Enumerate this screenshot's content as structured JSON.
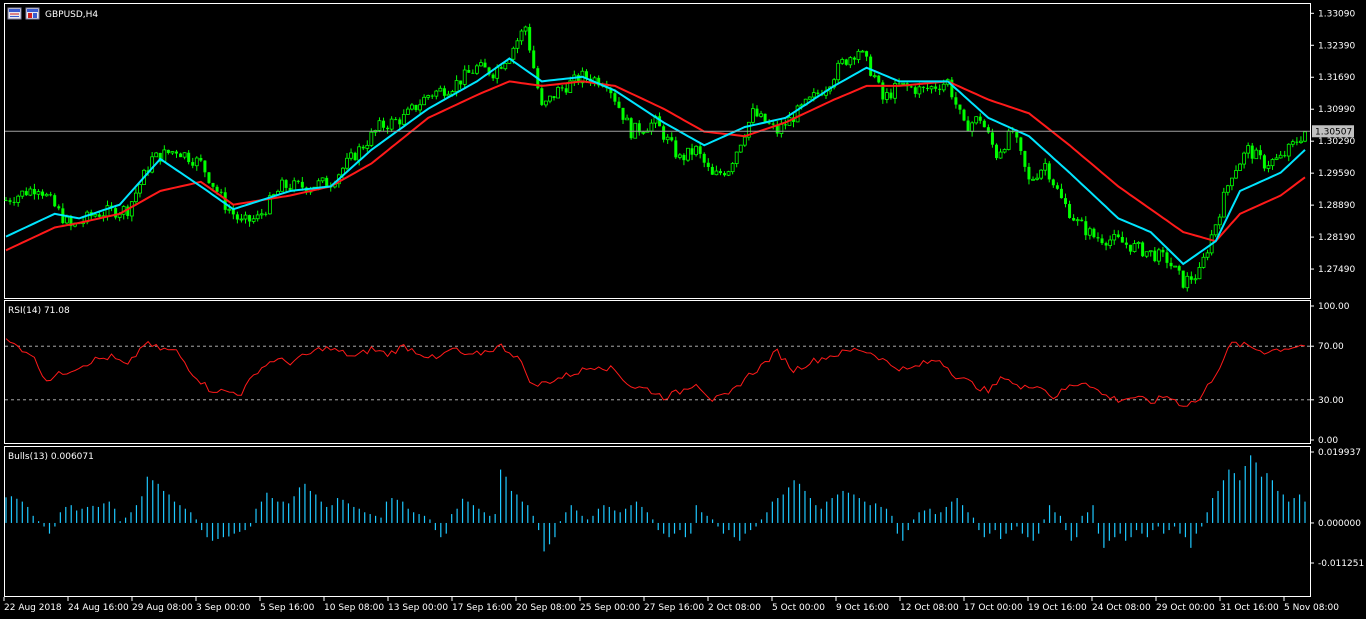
{
  "window": {
    "symbol_title": "GBPUSD,H4",
    "current_price_tag": "1.30507"
  },
  "colors": {
    "background": "#000000",
    "frame": "#ffffff",
    "candle": "#00ff00",
    "ma_fast": "#00e5ff",
    "ma_slow": "#ff1a1a",
    "rsi_line": "#ff1a1a",
    "bulls_hist": "#1ec8ff",
    "level_line": "#c0c0c0"
  },
  "icons": [
    "chart-window-icon",
    "chart-symbol-icon"
  ],
  "chart_data": [
    {
      "type": "candlestick",
      "symbol": "GBPUSD,H4",
      "ylim": [
        1.269,
        1.3325
      ],
      "y_ticks": [
        "1.33090",
        "1.32390",
        "1.31690",
        "1.30990",
        "1.30290",
        "1.29590",
        "1.28890",
        "1.28190",
        "1.27490"
      ],
      "current_price": 1.30507,
      "x_labels": [
        "22 Aug 2018",
        "24 Aug 16:00",
        "29 Aug 08:00",
        "3 Sep 00:00",
        "5 Sep 16:00",
        "10 Sep 08:00",
        "13 Sep 00:00",
        "17 Sep 16:00",
        "20 Sep 08:00",
        "25 Sep 00:00",
        "27 Sep 16:00",
        "2 Oct 08:00",
        "5 Oct 00:00",
        "9 Oct 16:00",
        "12 Oct 08:00",
        "17 Oct 00:00",
        "19 Oct 16:00",
        "24 Oct 08:00",
        "29 Oct 00:00",
        "31 Oct 16:00",
        "5 Nov 08:00"
      ],
      "close_path": [
        [
          0,
          1.29
        ],
        [
          8,
          1.293
        ],
        [
          16,
          1.284
        ],
        [
          22,
          1.287
        ],
        [
          30,
          1.288
        ],
        [
          36,
          1.299
        ],
        [
          42,
          1.301
        ],
        [
          48,
          1.298
        ],
        [
          54,
          1.289
        ],
        [
          58,
          1.285
        ],
        [
          62,
          1.286
        ],
        [
          68,
          1.293
        ],
        [
          74,
          1.293
        ],
        [
          80,
          1.294
        ],
        [
          86,
          1.3
        ],
        [
          92,
          1.306
        ],
        [
          98,
          1.308
        ],
        [
          104,
          1.313
        ],
        [
          110,
          1.315
        ],
        [
          116,
          1.319
        ],
        [
          120,
          1.318
        ],
        [
          124,
          1.322
        ],
        [
          128,
          1.328
        ],
        [
          132,
          1.31
        ],
        [
          136,
          1.314
        ],
        [
          142,
          1.317
        ],
        [
          148,
          1.316
        ],
        [
          154,
          1.305
        ],
        [
          160,
          1.307
        ],
        [
          166,
          1.299
        ],
        [
          170,
          1.301
        ],
        [
          174,
          1.295
        ],
        [
          178,
          1.297
        ],
        [
          184,
          1.309
        ],
        [
          190,
          1.305
        ],
        [
          196,
          1.31
        ],
        [
          202,
          1.315
        ],
        [
          206,
          1.32
        ],
        [
          210,
          1.323
        ],
        [
          214,
          1.317
        ],
        [
          216,
          1.312
        ],
        [
          220,
          1.315
        ],
        [
          226,
          1.314
        ],
        [
          232,
          1.316
        ],
        [
          236,
          1.306
        ],
        [
          240,
          1.308
        ],
        [
          244,
          1.3
        ],
        [
          248,
          1.305
        ],
        [
          252,
          1.294
        ],
        [
          256,
          1.298
        ],
        [
          260,
          1.29
        ],
        [
          264,
          1.285
        ],
        [
          268,
          1.282
        ],
        [
          274,
          1.281
        ],
        [
          280,
          1.279
        ],
        [
          286,
          1.277
        ],
        [
          290,
          1.272
        ],
        [
          294,
          1.274
        ],
        [
          298,
          1.285
        ],
        [
          302,
          1.296
        ],
        [
          306,
          1.301
        ],
        [
          310,
          1.298
        ],
        [
          314,
          1.299
        ],
        [
          320,
          1.305
        ]
      ],
      "ma_fast_path": [
        [
          0,
          1.282
        ],
        [
          12,
          1.287
        ],
        [
          18,
          1.286
        ],
        [
          28,
          1.289
        ],
        [
          38,
          1.299
        ],
        [
          48,
          1.293
        ],
        [
          56,
          1.288
        ],
        [
          70,
          1.292
        ],
        [
          80,
          1.293
        ],
        [
          90,
          1.301
        ],
        [
          104,
          1.31
        ],
        [
          116,
          1.316
        ],
        [
          124,
          1.321
        ],
        [
          132,
          1.316
        ],
        [
          142,
          1.317
        ],
        [
          150,
          1.314
        ],
        [
          162,
          1.307
        ],
        [
          172,
          1.302
        ],
        [
          182,
          1.306
        ],
        [
          192,
          1.308
        ],
        [
          204,
          1.315
        ],
        [
          212,
          1.319
        ],
        [
          220,
          1.316
        ],
        [
          232,
          1.316
        ],
        [
          242,
          1.308
        ],
        [
          252,
          1.304
        ],
        [
          262,
          1.296
        ],
        [
          274,
          1.286
        ],
        [
          282,
          1.283
        ],
        [
          290,
          1.276
        ],
        [
          298,
          1.281
        ],
        [
          304,
          1.292
        ],
        [
          314,
          1.296
        ],
        [
          320,
          1.301
        ]
      ],
      "ma_slow_path": [
        [
          0,
          1.279
        ],
        [
          12,
          1.284
        ],
        [
          18,
          1.285
        ],
        [
          28,
          1.287
        ],
        [
          38,
          1.292
        ],
        [
          48,
          1.294
        ],
        [
          56,
          1.289
        ],
        [
          70,
          1.291
        ],
        [
          80,
          1.293
        ],
        [
          90,
          1.298
        ],
        [
          104,
          1.308
        ],
        [
          116,
          1.313
        ],
        [
          124,
          1.316
        ],
        [
          132,
          1.315
        ],
        [
          142,
          1.316
        ],
        [
          150,
          1.315
        ],
        [
          162,
          1.31
        ],
        [
          172,
          1.305
        ],
        [
          182,
          1.304
        ],
        [
          192,
          1.307
        ],
        [
          204,
          1.312
        ],
        [
          212,
          1.315
        ],
        [
          220,
          1.315
        ],
        [
          232,
          1.316
        ],
        [
          242,
          1.312
        ],
        [
          252,
          1.309
        ],
        [
          262,
          1.302
        ],
        [
          274,
          1.293
        ],
        [
          282,
          1.288
        ],
        [
          290,
          1.283
        ],
        [
          298,
          1.281
        ],
        [
          304,
          1.287
        ],
        [
          314,
          1.291
        ],
        [
          320,
          1.295
        ]
      ]
    },
    {
      "type": "line",
      "title": "RSI(14) 71.08",
      "ylim": [
        0,
        100
      ],
      "y_ticks": [
        "100.00",
        "70.00",
        "30.00",
        "0.00"
      ],
      "levels": [
        70,
        30
      ],
      "series": [
        {
          "name": "RSI(14)",
          "points": [
            [
              0,
              74
            ],
            [
              6,
              65
            ],
            [
              10,
              45
            ],
            [
              14,
              50
            ],
            [
              18,
              55
            ],
            [
              22,
              60
            ],
            [
              26,
              62
            ],
            [
              30,
              55
            ],
            [
              34,
              72
            ],
            [
              38,
              68
            ],
            [
              42,
              66
            ],
            [
              46,
              50
            ],
            [
              50,
              38
            ],
            [
              54,
              36
            ],
            [
              58,
              35
            ],
            [
              62,
              52
            ],
            [
              66,
              60
            ],
            [
              70,
              58
            ],
            [
              74,
              63
            ],
            [
              78,
              69
            ],
            [
              82,
              66
            ],
            [
              86,
              62
            ],
            [
              90,
              68
            ],
            [
              94,
              64
            ],
            [
              98,
              70
            ],
            [
              102,
              65
            ],
            [
              106,
              60
            ],
            [
              110,
              68
            ],
            [
              114,
              62
            ],
            [
              118,
              66
            ],
            [
              122,
              70
            ],
            [
              126,
              62
            ],
            [
              130,
              40
            ],
            [
              134,
              44
            ],
            [
              138,
              48
            ],
            [
              142,
              52
            ],
            [
              146,
              56
            ],
            [
              150,
              52
            ],
            [
              154,
              40
            ],
            [
              158,
              38
            ],
            [
              162,
              32
            ],
            [
              166,
              36
            ],
            [
              170,
              43
            ],
            [
              174,
              30
            ],
            [
              178,
              33
            ],
            [
              182,
              46
            ],
            [
              186,
              55
            ],
            [
              190,
              66
            ],
            [
              194,
              52
            ],
            [
              198,
              58
            ],
            [
              202,
              62
            ],
            [
              206,
              65
            ],
            [
              210,
              68
            ],
            [
              214,
              64
            ],
            [
              218,
              56
            ],
            [
              222,
              52
            ],
            [
              226,
              57
            ],
            [
              230,
              60
            ],
            [
              234,
              48
            ],
            [
              238,
              42
            ],
            [
              242,
              36
            ],
            [
              246,
              48
            ],
            [
              250,
              38
            ],
            [
              254,
              42
            ],
            [
              258,
              32
            ],
            [
              262,
              40
            ],
            [
              266,
              44
            ],
            [
              270,
              34
            ],
            [
              274,
              30
            ],
            [
              278,
              32
            ],
            [
              282,
              28
            ],
            [
              286,
              33
            ],
            [
              290,
              26
            ],
            [
              294,
              30
            ],
            [
              298,
              50
            ],
            [
              302,
              72
            ],
            [
              306,
              70
            ],
            [
              310,
              66
            ],
            [
              314,
              68
            ],
            [
              320,
              71
            ]
          ]
        }
      ]
    },
    {
      "type": "bar",
      "title": "Bulls(13) 0.006071",
      "ylim": [
        -0.011251,
        0.019937
      ],
      "y_ticks": [
        "0.019937",
        "0.000000",
        "-0.011251"
      ],
      "series": [
        {
          "name": "Bulls(13)",
          "values": [
            0.0072,
            0.0075,
            0.0068,
            0.006,
            0.0045,
            0.002,
            0.0005,
            -0.001,
            -0.003,
            -0.001,
            0.003,
            0.0045,
            0.005,
            0.0035,
            0.004,
            0.0045,
            0.0048,
            0.0045,
            0.0055,
            0.006,
            0.004,
            0.0005,
            0.0015,
            0.003,
            0.005,
            0.0075,
            0.013,
            0.012,
            0.011,
            0.009,
            0.008,
            0.006,
            0.005,
            0.004,
            0.003,
            0.001,
            -0.002,
            -0.004,
            -0.005,
            -0.0045,
            -0.004,
            -0.0038,
            -0.003,
            -0.0025,
            -0.002,
            -0.001,
            0.004,
            0.006,
            0.0085,
            0.007,
            0.006,
            0.006,
            0.0055,
            0.0075,
            0.01,
            0.011,
            0.009,
            0.008,
            0.006,
            0.0045,
            0.005,
            0.007,
            0.0065,
            0.0055,
            0.0045,
            0.004,
            0.003,
            0.0025,
            0.002,
            0.0015,
            0.006,
            0.007,
            0.0065,
            0.006,
            0.004,
            0.003,
            0.0025,
            0.002,
            0.001,
            -0.002,
            -0.004,
            -0.003,
            0.0025,
            0.004,
            0.0068,
            0.006,
            0.005,
            0.004,
            0.003,
            0.002,
            0.0025,
            0.015,
            0.013,
            0.009,
            0.008,
            0.006,
            0.005,
            0.002,
            -0.002,
            -0.008,
            -0.006,
            -0.004,
            0.0005,
            0.003,
            0.005,
            0.0035,
            0.002,
            0.001,
            0.002,
            0.004,
            0.005,
            0.0045,
            0.0035,
            0.003,
            0.004,
            0.005,
            0.006,
            0.0045,
            0.003,
            0.001,
            -0.002,
            -0.003,
            -0.004,
            -0.003,
            -0.002,
            -0.004,
            -0.003,
            0.005,
            0.003,
            0.002,
            0.001,
            -0.001,
            -0.003,
            -0.002,
            -0.004,
            -0.005,
            -0.003,
            -0.002,
            -0.001,
            0.001,
            0.003,
            0.006,
            0.007,
            0.008,
            0.01,
            0.012,
            0.011,
            0.009,
            0.007,
            0.005,
            0.004,
            0.006,
            0.007,
            0.008,
            0.009,
            0.0085,
            0.008,
            0.007,
            0.006,
            0.005,
            0.0055,
            0.0045,
            0.004,
            0.002,
            -0.003,
            -0.005,
            -0.002,
            0.001,
            0.003,
            0.0035,
            0.004,
            0.0025,
            0.003,
            0.0045,
            0.006,
            0.007,
            0.005,
            0.003,
            0.0015,
            -0.002,
            -0.004,
            -0.003,
            -0.002,
            -0.0045,
            -0.003,
            -0.002,
            -0.001,
            -0.003,
            -0.004,
            -0.005,
            -0.003,
            0.001,
            0.005,
            0.003,
            0.002,
            -0.002,
            -0.005,
            -0.004,
            0.002,
            0.003,
            0.005,
            -0.003,
            -0.007,
            -0.005,
            -0.004,
            -0.003,
            -0.005,
            -0.004,
            -0.002,
            -0.003,
            -0.004,
            -0.002,
            -0.001,
            -0.003,
            -0.002,
            -0.001,
            -0.003,
            -0.004,
            -0.007,
            -0.003,
            -0.001,
            0.003,
            0.007,
            0.009,
            0.012,
            0.015,
            0.014,
            0.012,
            0.016,
            0.019,
            0.017,
            0.013,
            0.014,
            0.012,
            0.009,
            0.008,
            0.006,
            0.007,
            0.008,
            0.006
          ]
        }
      ]
    }
  ]
}
